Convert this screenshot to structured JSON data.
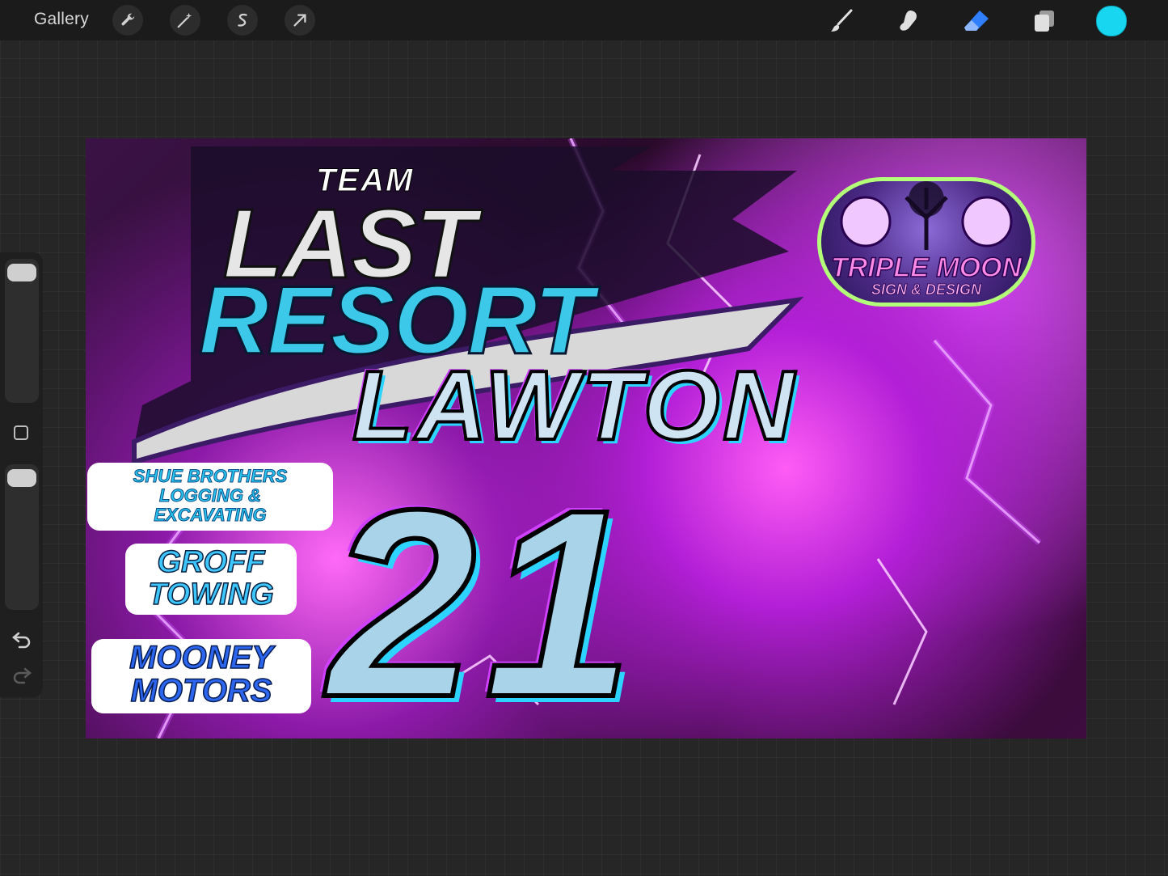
{
  "toolbar": {
    "gallery_label": "Gallery",
    "left_tools": [
      "wrench-icon",
      "magic-wand-icon",
      "selection-icon",
      "transform-arrow-icon"
    ],
    "right_tools": [
      "brush-icon",
      "smudge-icon",
      "eraser-icon",
      "layers-icon"
    ],
    "current_color": "#19d6f0"
  },
  "sidebar": {
    "tools": [
      "brush-size-slider",
      "modify-button",
      "opacity-slider",
      "undo-icon",
      "redo-icon"
    ]
  },
  "artwork": {
    "logo": {
      "team": "TEAM",
      "last": "LAST",
      "resort": "RESORT"
    },
    "driver_name": "LAWTON",
    "car_number": "21",
    "badge": {
      "title": "TRIPLE MOON",
      "subtitle": "SIGN & DESIGN"
    },
    "sponsors": [
      {
        "line1": "SHUE BROTHERS",
        "line2": "LOGGING &",
        "line3": "EXCAVATING"
      },
      {
        "line1": "GROFF",
        "line2": "TOWING"
      },
      {
        "line1": "MOONEY",
        "line2": "MOTORS"
      }
    ]
  }
}
